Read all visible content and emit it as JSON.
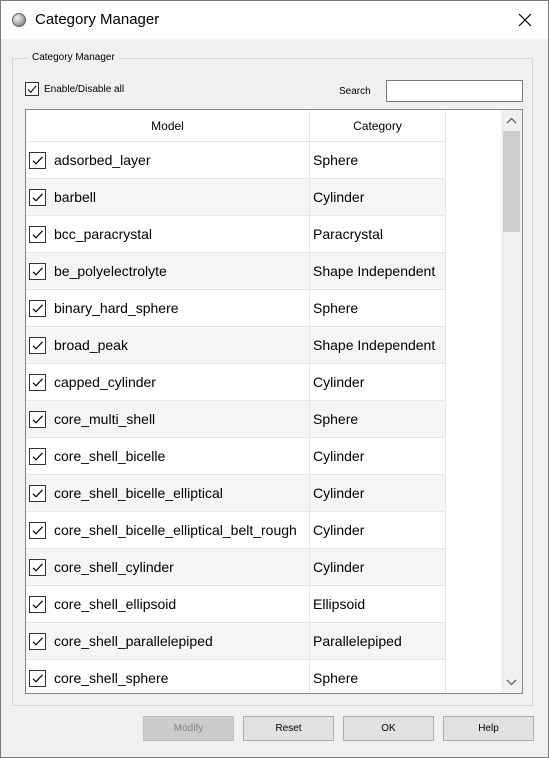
{
  "window": {
    "title": "Category Manager"
  },
  "group": {
    "title": "Category Manager"
  },
  "enable_all": {
    "label": "Enable/Disable all",
    "checked": true
  },
  "search": {
    "label": "Search",
    "value": ""
  },
  "table": {
    "columns": [
      "Model",
      "Category"
    ],
    "rows": [
      {
        "model": "adsorbed_layer",
        "category": "Sphere",
        "checked": true
      },
      {
        "model": "barbell",
        "category": "Cylinder",
        "checked": true
      },
      {
        "model": "bcc_paracrystal",
        "category": "Paracrystal",
        "checked": true
      },
      {
        "model": "be_polyelectrolyte",
        "category": "Shape Independent",
        "checked": true
      },
      {
        "model": "binary_hard_sphere",
        "category": "Sphere",
        "checked": true
      },
      {
        "model": "broad_peak",
        "category": "Shape Independent",
        "checked": true
      },
      {
        "model": "capped_cylinder",
        "category": "Cylinder",
        "checked": true
      },
      {
        "model": "core_multi_shell",
        "category": "Sphere",
        "checked": true
      },
      {
        "model": "core_shell_bicelle",
        "category": "Cylinder",
        "checked": true
      },
      {
        "model": "core_shell_bicelle_elliptical",
        "category": "Cylinder",
        "checked": true
      },
      {
        "model": "core_shell_bicelle_elliptical_belt_rough",
        "category": "Cylinder",
        "checked": true
      },
      {
        "model": "core_shell_cylinder",
        "category": "Cylinder",
        "checked": true
      },
      {
        "model": "core_shell_ellipsoid",
        "category": "Ellipsoid",
        "checked": true
      },
      {
        "model": "core_shell_parallelepiped",
        "category": "Parallelepiped",
        "checked": true
      },
      {
        "model": "core_shell_sphere",
        "category": "Sphere",
        "checked": true
      }
    ]
  },
  "buttons": {
    "modify": {
      "label": "Modify",
      "enabled": false
    },
    "reset": {
      "label": "Reset",
      "enabled": true
    },
    "ok": {
      "label": "OK",
      "enabled": true
    },
    "help": {
      "label": "Help",
      "enabled": true
    }
  }
}
